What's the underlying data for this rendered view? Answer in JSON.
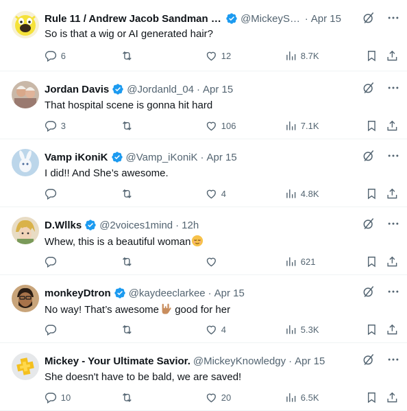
{
  "colors": {
    "text_primary": "#0f1419",
    "text_secondary": "#536471",
    "verified_blue": "#1d9bf0",
    "divider": "#eff3f4"
  },
  "tweets": [
    {
      "name": "Rule 11 / Andrew Jacob Sandman Say...",
      "verified": true,
      "handle": "@MickeySte...",
      "time": "Apr 15",
      "text": "So is that a wig or AI generated hair?",
      "emoji": "",
      "replies": "6",
      "retweets": "",
      "likes": "12",
      "views": "8.7K",
      "avatar_icon": "yellow-cartoon-avatar-icon"
    },
    {
      "name": "Jordan Davis",
      "verified": true,
      "handle": "@Jordanld_04",
      "time": "Apr 15",
      "text": "That hospital scene is gonna hit hard",
      "emoji": "",
      "replies": "3",
      "retweets": "",
      "likes": "106",
      "views": "7.1K",
      "avatar_icon": "photo-avatar-icon"
    },
    {
      "name": "Vamp iKoniK",
      "verified": true,
      "handle": "@Vamp_iKoniK",
      "time": "Apr 15",
      "text": "I did!! And She’s awesome.",
      "emoji": "",
      "replies": "",
      "retweets": "",
      "likes": "4",
      "views": "4.8K",
      "avatar_icon": "white-character-avatar-icon"
    },
    {
      "name": "D.Wllks",
      "verified": true,
      "handle": "@2voices1mind",
      "time": "12h",
      "text": "Whew, this is a beautiful woman",
      "emoji": "relieved-face-emoji",
      "replies": "",
      "retweets": "",
      "likes": "",
      "views": "621",
      "avatar_icon": "anime-avatar-icon"
    },
    {
      "name": "monkeyDtron",
      "verified": true,
      "handle": "@kaydeeclarkee",
      "time": "Apr 15",
      "text": "No way! That’s awesome",
      "text_after": " good for her",
      "emoji": "love-you-gesture-emoji",
      "replies": "",
      "retweets": "",
      "likes": "4",
      "views": "5.3K",
      "avatar_icon": "cartoon-man-avatar-icon"
    },
    {
      "name": "Mickey - Your Ultimate Savior.",
      "verified": false,
      "handle": "@MickeyKnowledgy",
      "time": "Apr 15",
      "text": "She doesn't have to be bald, we are saved!",
      "emoji": "",
      "replies": "10",
      "retweets": "",
      "likes": "20",
      "views": "6.5K",
      "avatar_icon": "playstation-plus-avatar-icon"
    }
  ]
}
